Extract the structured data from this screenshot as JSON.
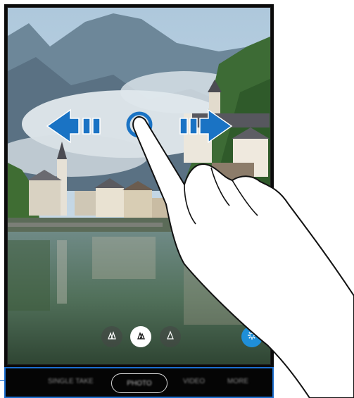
{
  "lens_buttons": [
    {
      "name": "ultra-wide-lens-icon",
      "active": false
    },
    {
      "name": "wide-lens-icon",
      "active": true
    },
    {
      "name": "tele-lens-icon",
      "active": false
    }
  ],
  "bixby_button": {
    "icon": "bixby-vision-icon",
    "color": "#1f8fd8"
  },
  "camera_modes": {
    "left_1": "SINGLE TAKE",
    "current": "PHOTO",
    "right_1": "VIDEO",
    "right_2": "MORE"
  },
  "gesture": {
    "type": "swipe-left-right",
    "arrow_color": "#1a73c4"
  },
  "accent_color": "#1c6fd0"
}
